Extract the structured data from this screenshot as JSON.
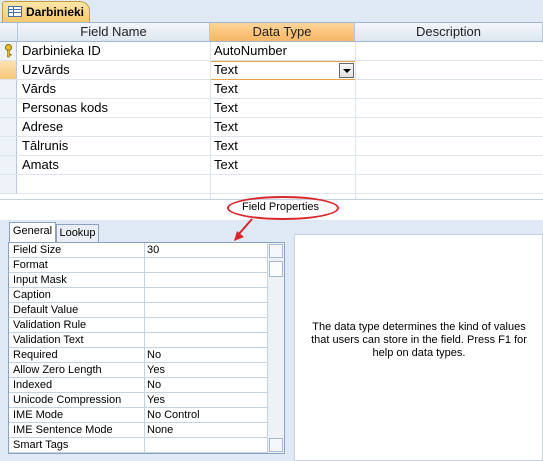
{
  "doc_tab": {
    "title": "Darbinieki",
    "icon": "table-icon"
  },
  "grid": {
    "headers": [
      "Field Name",
      "Data Type",
      "Description"
    ],
    "rows": [
      {
        "name": "Darbinieka ID",
        "type": "AutoNumber",
        "key": true
      },
      {
        "name": "Uzvārds",
        "type": "Text",
        "current": true
      },
      {
        "name": "Vārds",
        "type": "Text"
      },
      {
        "name": "Personas kods",
        "type": "Text"
      },
      {
        "name": "Adrese",
        "type": "Text"
      },
      {
        "name": "Tālrunis",
        "type": "Text"
      },
      {
        "name": "Amats",
        "type": "Text"
      }
    ]
  },
  "field_properties_label": "Field Properties",
  "tabs": [
    "General",
    "Lookup"
  ],
  "properties": [
    {
      "name": "Field Size",
      "value": "30"
    },
    {
      "name": "Format",
      "value": ""
    },
    {
      "name": "Input Mask",
      "value": ""
    },
    {
      "name": "Caption",
      "value": ""
    },
    {
      "name": "Default Value",
      "value": ""
    },
    {
      "name": "Validation Rule",
      "value": ""
    },
    {
      "name": "Validation Text",
      "value": ""
    },
    {
      "name": "Required",
      "value": "No"
    },
    {
      "name": "Allow Zero Length",
      "value": "Yes"
    },
    {
      "name": "Indexed",
      "value": "No"
    },
    {
      "name": "Unicode Compression",
      "value": "Yes"
    },
    {
      "name": "IME Mode",
      "value": "No Control"
    },
    {
      "name": "IME Sentence Mode",
      "value": "None"
    },
    {
      "name": "Smart Tags",
      "value": ""
    }
  ],
  "help_text": "The data type determines the kind of values that users can store in the field. Press F1 for help on data types.",
  "colors": {
    "highlight": "#d9262c",
    "selected_header": "#f6b763",
    "panel": "#dfe9f5"
  }
}
